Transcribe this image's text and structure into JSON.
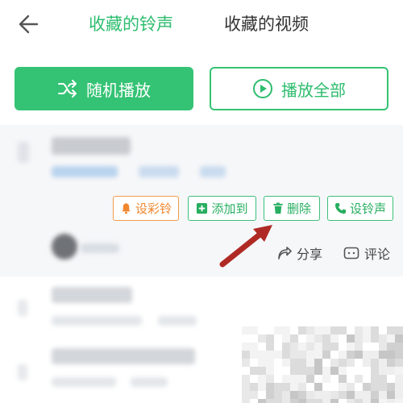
{
  "tabs": {
    "active": "收藏的铃声",
    "inactive": "收藏的视频"
  },
  "buttons": {
    "shuffle_play": "随机播放",
    "play_all": "播放全部"
  },
  "song_actions": {
    "set_color_ring": "设彩铃",
    "add_to": "添加到",
    "delete": "删除",
    "set_ringtone": "设铃声",
    "share": "分享",
    "comment": "评论"
  },
  "colors": {
    "accent_green": "#34c374",
    "accent_orange": "#f0862d",
    "arrow_red": "#b02a25"
  },
  "icons": {
    "back": "back-arrow-icon",
    "shuffle": "shuffle-icon",
    "play": "play-circle-icon",
    "bell": "bell-icon",
    "add": "add-square-icon",
    "delete": "trash-icon",
    "phone": "phone-icon",
    "share": "share-icon",
    "comment": "comment-icon"
  }
}
